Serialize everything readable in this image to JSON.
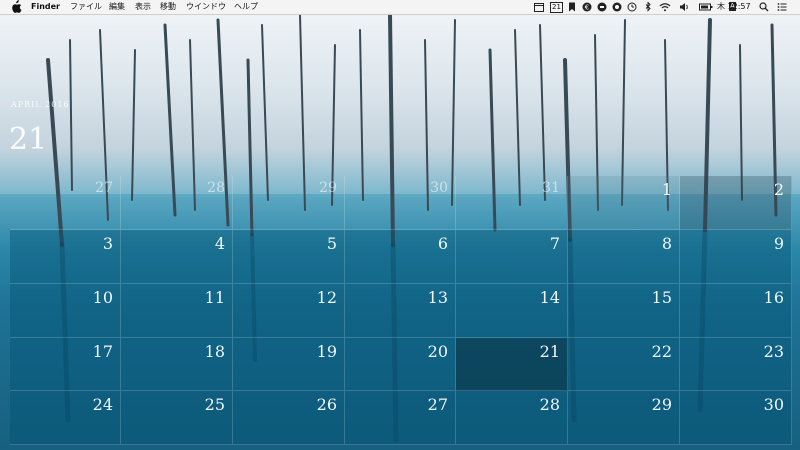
{
  "menubar": {
    "apple_icon": "apple-icon",
    "app_name": "Finder",
    "menus": [
      "ファイル",
      "編集",
      "表示",
      "移動",
      "ウインドウ",
      "ヘルプ"
    ],
    "status": {
      "calendar_badge": "21",
      "keyboard_badge": "A",
      "clock": "木 12:57",
      "icons": [
        "menu-calendar-icon",
        "calendar-date-icon",
        "bookmark-icon",
        "cloud-app-icon",
        "stop-icon",
        "record-icon",
        "do-not-disturb-icon",
        "flower-icon",
        "time-machine-icon",
        "bluetooth-icon",
        "wifi-icon",
        "volume-icon",
        "battery-icon",
        "input-source-icon",
        "spotlight-icon",
        "notification-center-icon"
      ]
    }
  },
  "calendar": {
    "month_label": "APRIL 2016",
    "big_day": "21",
    "today": "21",
    "weeks": [
      [
        {
          "d": "27",
          "t": "other"
        },
        {
          "d": "28",
          "t": "other"
        },
        {
          "d": "29",
          "t": "other"
        },
        {
          "d": "30",
          "t": "other"
        },
        {
          "d": "31",
          "t": "other"
        },
        {
          "d": "1",
          "t": "faint"
        },
        {
          "d": "2",
          "t": "weekend"
        }
      ],
      [
        {
          "d": "3",
          "t": "cur"
        },
        {
          "d": "4",
          "t": "cur"
        },
        {
          "d": "5",
          "t": "cur"
        },
        {
          "d": "6",
          "t": "cur"
        },
        {
          "d": "7",
          "t": "cur"
        },
        {
          "d": "8",
          "t": "cur"
        },
        {
          "d": "9",
          "t": "cur"
        }
      ],
      [
        {
          "d": "10",
          "t": "cur"
        },
        {
          "d": "11",
          "t": "cur"
        },
        {
          "d": "12",
          "t": "cur"
        },
        {
          "d": "13",
          "t": "cur"
        },
        {
          "d": "14",
          "t": "cur"
        },
        {
          "d": "15",
          "t": "cur"
        },
        {
          "d": "16",
          "t": "cur"
        }
      ],
      [
        {
          "d": "17",
          "t": "cur"
        },
        {
          "d": "18",
          "t": "cur"
        },
        {
          "d": "19",
          "t": "cur"
        },
        {
          "d": "20",
          "t": "cur"
        },
        {
          "d": "21",
          "t": "today"
        },
        {
          "d": "22",
          "t": "cur"
        },
        {
          "d": "23",
          "t": "cur"
        }
      ],
      [
        {
          "d": "24",
          "t": "cur"
        },
        {
          "d": "25",
          "t": "cur"
        },
        {
          "d": "26",
          "t": "cur"
        },
        {
          "d": "27",
          "t": "cur"
        },
        {
          "d": "28",
          "t": "cur"
        },
        {
          "d": "29",
          "t": "cur"
        },
        {
          "d": "30",
          "t": "cur"
        }
      ]
    ]
  },
  "wallpaper": {
    "subject": "frozen-trees-blue-pond"
  }
}
